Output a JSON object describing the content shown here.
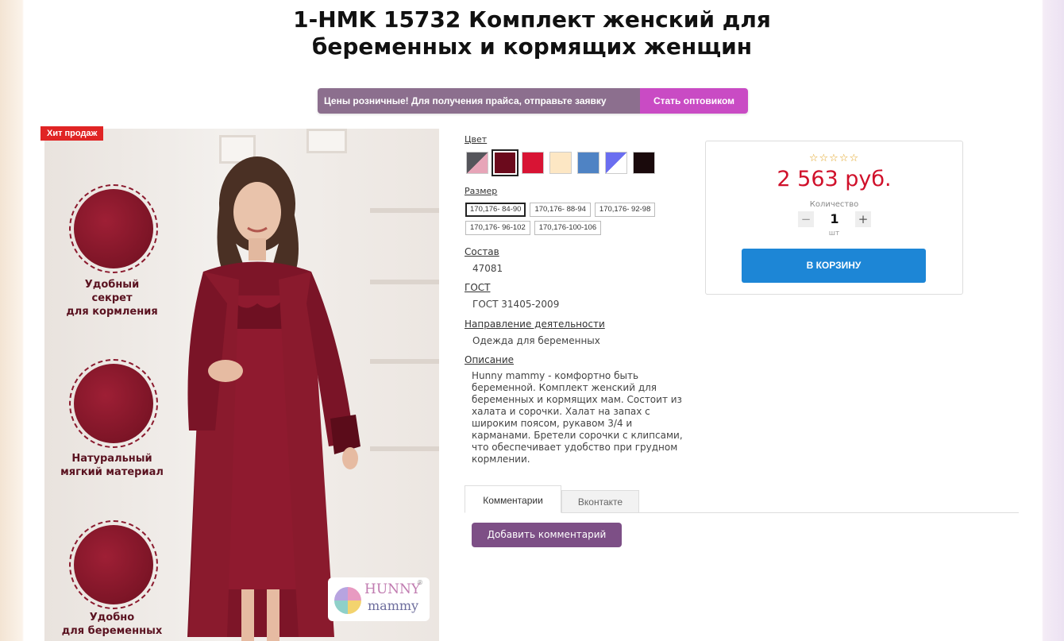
{
  "product": {
    "title_line1": "1-HMK 15732 Комплект женский для",
    "title_line2": "беременных и кормящих женщин"
  },
  "banner": {
    "message": "Цены розничные! Для получения прайса, отправьте заявку",
    "cta": "Стать оптовиком"
  },
  "image": {
    "badge": "Хит продаж",
    "features": [
      {
        "line1": "Удобный",
        "line2": "секрет",
        "line3": "для кормления"
      },
      {
        "line1": "Натуральный",
        "line2": "мягкий материал"
      },
      {
        "line1": "Удобно",
        "line2": "для беременных"
      }
    ],
    "logo_text": "HUNNY",
    "logo_sub": "mammy",
    "logo_reg": "®"
  },
  "props": {
    "color_label": "Цвет",
    "colors": [
      "#55555b/#e7a5b8",
      "#6b0a1c",
      "#d81434",
      "#fde7c4",
      "#4f83c4",
      "#6a6ef0/#ffffff",
      "#1a0a0c"
    ],
    "size_label": "Размер",
    "sizes": [
      "170,176- 84-90",
      "170,176- 88-94",
      "170,176- 92-98",
      "170,176- 96-102",
      "170,176-100-106"
    ],
    "composition_label": "Состав",
    "composition_value": "47081",
    "gost_label": "ГОСТ",
    "gost_value": "ГОСТ 31405-2009",
    "direction_label": "Направление деятельности",
    "direction_value": "Одежда для беременных",
    "description_label": "Описание",
    "description_value": "Hunny mammy - комфортно быть беременной. Комплект женский для беременных и кормящих мам. Состоит из халата и сорочки. Халат на запах с широким поясом, рукавом 3/4 и карманами. Бретели сорочки с клипсами, что обеспечивает удобство при грудном кормлении."
  },
  "buy": {
    "stars": "☆☆☆☆☆",
    "rating": 0,
    "price": "2 563 руб.",
    "quantity_label": "Количество",
    "quantity": "1",
    "minus": "−",
    "plus": "+",
    "unit": "шт",
    "cart_button": "В КОРЗИНУ"
  },
  "tabs": {
    "comments": "Комментарии",
    "vk": "Вконтакте",
    "add_comment": "Добавить комментарий"
  }
}
